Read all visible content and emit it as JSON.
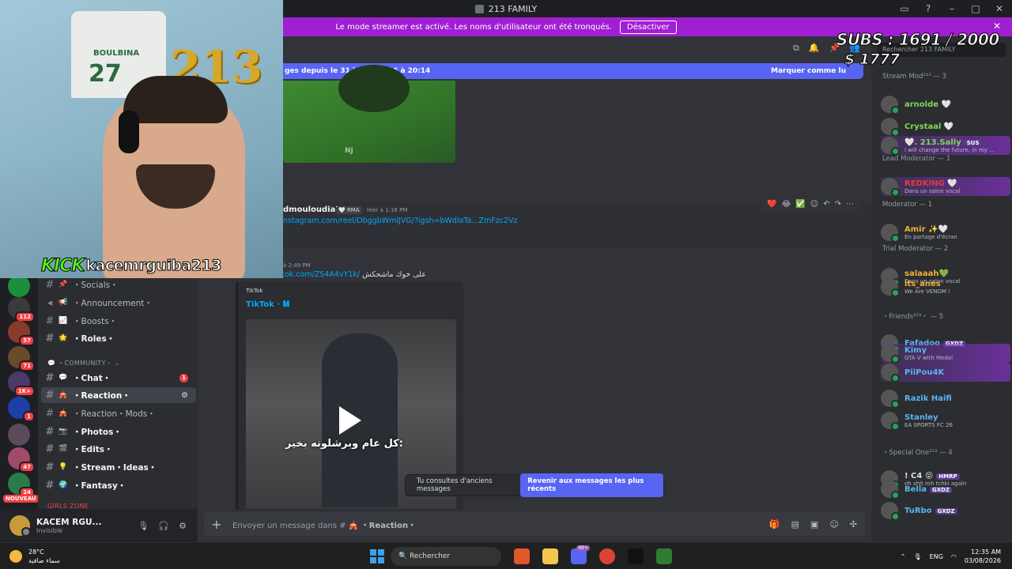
{
  "window": {
    "title": "213 FAMILY"
  },
  "banner": {
    "text": "Le mode streamer est activé. Les noms d'utilisateur ont été tronqués.",
    "button": "Désactiver"
  },
  "rail": {
    "badges": [
      "112",
      "57",
      "71",
      "1K+",
      "1",
      "47",
      "24"
    ],
    "nouveau": "NOUVEAU"
  },
  "channels": {
    "items": [
      {
        "emoji": "📌",
        "label": "・Socials・"
      },
      {
        "emoji": "📢",
        "label": "・Announcement・"
      },
      {
        "emoji": "📈",
        "label": "・Boosts・"
      },
      {
        "emoji": "🌟",
        "label": "・Roles・"
      }
    ],
    "category": "・COMMUNITY・",
    "community": [
      {
        "emoji": "💬",
        "label": "・Chat・",
        "badge": "1"
      },
      {
        "emoji": "🎪",
        "label": "・Reaction・"
      },
      {
        "emoji": "🎪",
        "label": "・Reaction・Mods・"
      },
      {
        "emoji": "📷",
        "label": "・Photos・"
      },
      {
        "emoji": "🎬",
        "label": "・Edits・"
      },
      {
        "emoji": "💡",
        "label": "・Stream・Ideas・"
      },
      {
        "emoji": "🌍",
        "label": "・Fantasy・"
      }
    ],
    "category2": "GIRLS ZONE"
  },
  "user": {
    "name": "KACEM RGU...",
    "status": "Invisible"
  },
  "chat": {
    "newbar_text": "ges depuis le 31 juillet 2026 à 20:14",
    "newbar_action": "Marquer comme lu",
    "embed_watermark": "NJ",
    "msg1": {
      "author": "dmouloudia76",
      "tag": "🤍 RMA",
      "time": "Hier à 1:16 PM",
      "link": "nstagram.com/reel/DbggbWmlJVG/?igsh=bWdlaTa...ZmFzc2Vz"
    },
    "reactions": [
      "❤️",
      "😂",
      "✅",
      "☺",
      "↶",
      "↷",
      "⋯"
    ],
    "msg2": {
      "time": "à 2:49 PM",
      "link": "https://vt.tiktok.com/ZS4A4vY1k/",
      "rtl": "على خوك ماشحكش"
    },
    "embed": {
      "provider": "TikTok",
      "title": "TikTok · 𝐌",
      "caption": "كل عام وبرشلونه بخير:"
    },
    "old_notice": "Tu consultes d'anciens messages",
    "old_button": "Revenir aux messages les plus récents",
    "composer_placeholder": "Envoyer un message dans #",
    "composer_channel": "🎪 ・Reaction・"
  },
  "members": {
    "search_placeholder": "Rechercher 213 FAMILY",
    "groups": [
      {
        "label": "Stream Mod²¹³ — 3",
        "members": [
          {
            "name": "arnolde 🤍",
            "color": "#7ed957",
            "sub": ""
          },
          {
            "name": "Crystaal 🤍",
            "color": "#7ed957",
            "sub": ""
          },
          {
            "name": "🤍. 213.Sally",
            "color": "#7ed957",
            "sub": "i will change the future, in my ...",
            "tag": "SUS",
            "hl": true
          }
        ]
      },
      {
        "label": "Lead Moderator — 1",
        "members": [
          {
            "name": "REDKING 🤍",
            "color": "#e23b3b",
            "sub": "Dans un salon vocal",
            "hl": true
          }
        ]
      },
      {
        "label": "Moderator — 1",
        "members": [
          {
            "name": "Amir ✨🤍",
            "color": "#f0b232",
            "sub": "En partage d'écran"
          }
        ]
      },
      {
        "label": "Trial Moderator — 2",
        "members": [
          {
            "name": "salaaah💚",
            "color": "#f0b232",
            "sub": "Dans un salon vocal"
          },
          {
            "name": "its_anes",
            "color": "#f0b232",
            "sub": "We Are VENOM !"
          }
        ]
      },
      {
        "label": "・Friends²¹³・ — 5",
        "members": [
          {
            "name": "Fafadoo",
            "color": "#5ab4f0",
            "sub": "",
            "tag": "GXDZ"
          },
          {
            "name": "Kimy",
            "color": "#5ab4f0",
            "sub": "GTA V with Medal",
            "hl": true
          },
          {
            "name": "PiiPou4K",
            "color": "#5ab4f0",
            "sub": "",
            "hl": true
          },
          {
            "name": "Razik Haifi",
            "color": "#5ab4f0",
            "sub": ""
          },
          {
            "name": "Stanley",
            "color": "#5ab4f0",
            "sub": "EA SPORTS FC 26"
          }
        ]
      },
      {
        "label": "・Special One²¹³ — 4",
        "members": [
          {
            "name": "! C4 😝",
            "color": "#dbdee1",
            "sub": "oh shit roh tchki again",
            "tag": "HMRP"
          },
          {
            "name": "Bella",
            "color": "#5ab4f0",
            "sub": "",
            "tag": "GXDZ"
          },
          {
            "name": "TuRbo",
            "color": "#5ab4f0",
            "sub": "",
            "tag": "GXDZ"
          }
        ]
      }
    ]
  },
  "overlay": {
    "kick": "KICK",
    "handle": "kacemrguiba213",
    "subs": "SUBS : 1691 / 2000",
    "dollars": "$ 1777",
    "jersey_name": "BOULBINA",
    "jersey_number": "27",
    "balloon": "213"
  },
  "taskbar": {
    "temp": "28°C",
    "weather": "سماء صافية",
    "search": "Rechercher",
    "lang": "ENG",
    "time": "12:35 AM",
    "date": "03/08/2026",
    "badge": "99+"
  }
}
